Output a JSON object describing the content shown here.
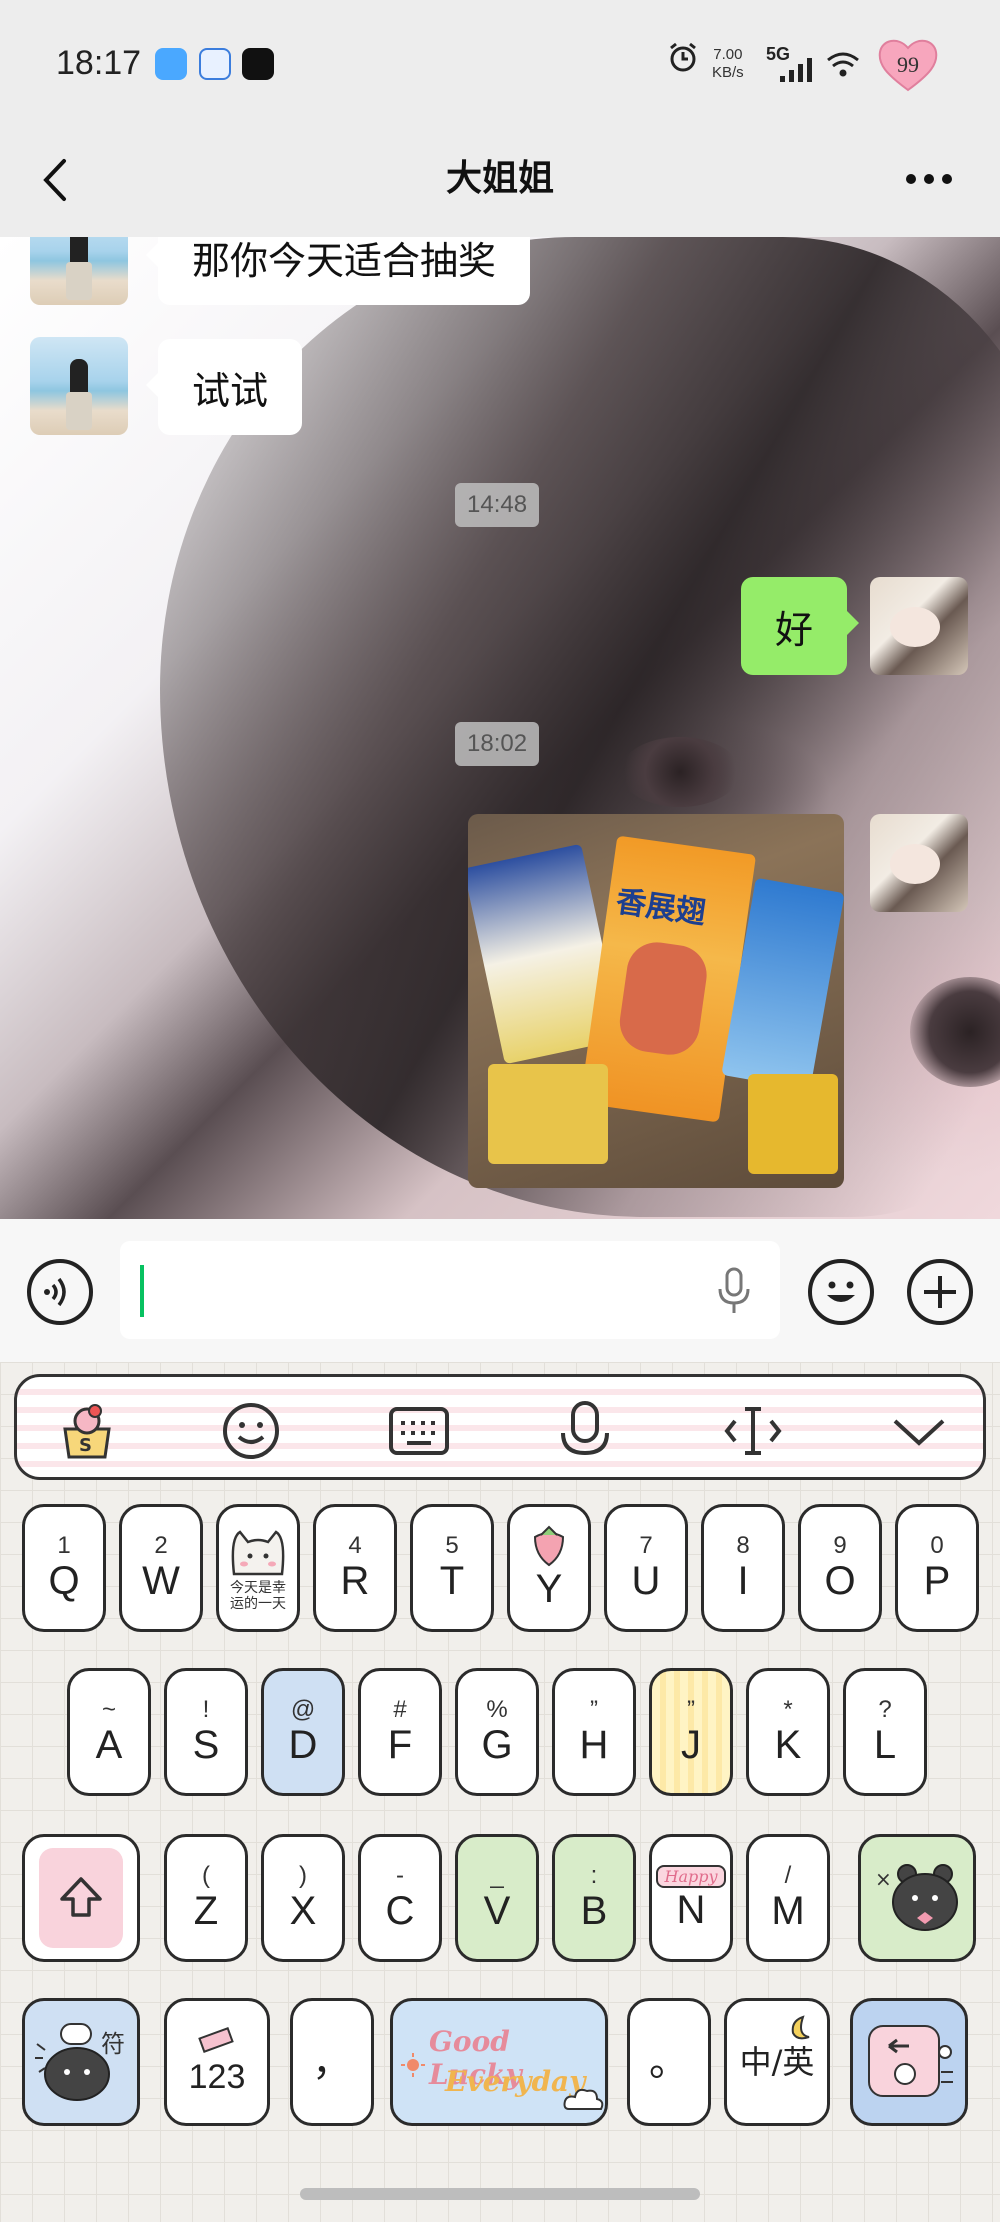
{
  "status_bar": {
    "time": "18:17",
    "net_speed": "7.00",
    "net_unit": "KB/s",
    "network": "5G",
    "badge": "99"
  },
  "nav": {
    "title": "大姐姐"
  },
  "messages": [
    {
      "side": "left",
      "text": "那你今天适合抽奖"
    },
    {
      "side": "left",
      "text": "试试"
    },
    {
      "type": "time",
      "text": "14:48"
    },
    {
      "side": "right",
      "text": "好"
    },
    {
      "type": "time",
      "text": "18:02"
    },
    {
      "side": "right",
      "type": "image",
      "bag_label": "香展翅"
    }
  ],
  "keyboard": {
    "row1": [
      {
        "sub": "1",
        "main": "Q"
      },
      {
        "sub": "2",
        "main": "W"
      },
      {
        "sub": "",
        "main": "",
        "sticker": "今天是幸运的一天"
      },
      {
        "sub": "4",
        "main": "R"
      },
      {
        "sub": "5",
        "main": "T"
      },
      {
        "sub": "",
        "main": "Y"
      },
      {
        "sub": "7",
        "main": "U"
      },
      {
        "sub": "8",
        "main": "I"
      },
      {
        "sub": "9",
        "main": "O"
      },
      {
        "sub": "0",
        "main": "P"
      }
    ],
    "row2": [
      {
        "sub": "~",
        "main": "A"
      },
      {
        "sub": "!",
        "main": "S"
      },
      {
        "sub": "@",
        "main": "D"
      },
      {
        "sub": "#",
        "main": "F"
      },
      {
        "sub": "%",
        "main": "G"
      },
      {
        "sub": "”",
        "main": "H"
      },
      {
        "sub": "”",
        "main": "J"
      },
      {
        "sub": "*",
        "main": "K"
      },
      {
        "sub": "?",
        "main": "L"
      }
    ],
    "row3": [
      {
        "sub": "(",
        "main": "Z"
      },
      {
        "sub": ")",
        "main": "X"
      },
      {
        "sub": "-",
        "main": "C"
      },
      {
        "sub": "_",
        "main": "V"
      },
      {
        "sub": ":",
        "main": "B"
      },
      {
        "sub": "",
        "main": "N",
        "sticker": "Happy"
      },
      {
        "sub": "/",
        "main": "M"
      }
    ],
    "symbol_key": "符",
    "num_key": "123",
    "comma_key": "，",
    "space_line1": "Good Lucky",
    "space_line2": "Everyday",
    "period_key": "。",
    "lang_key": "中/英"
  }
}
